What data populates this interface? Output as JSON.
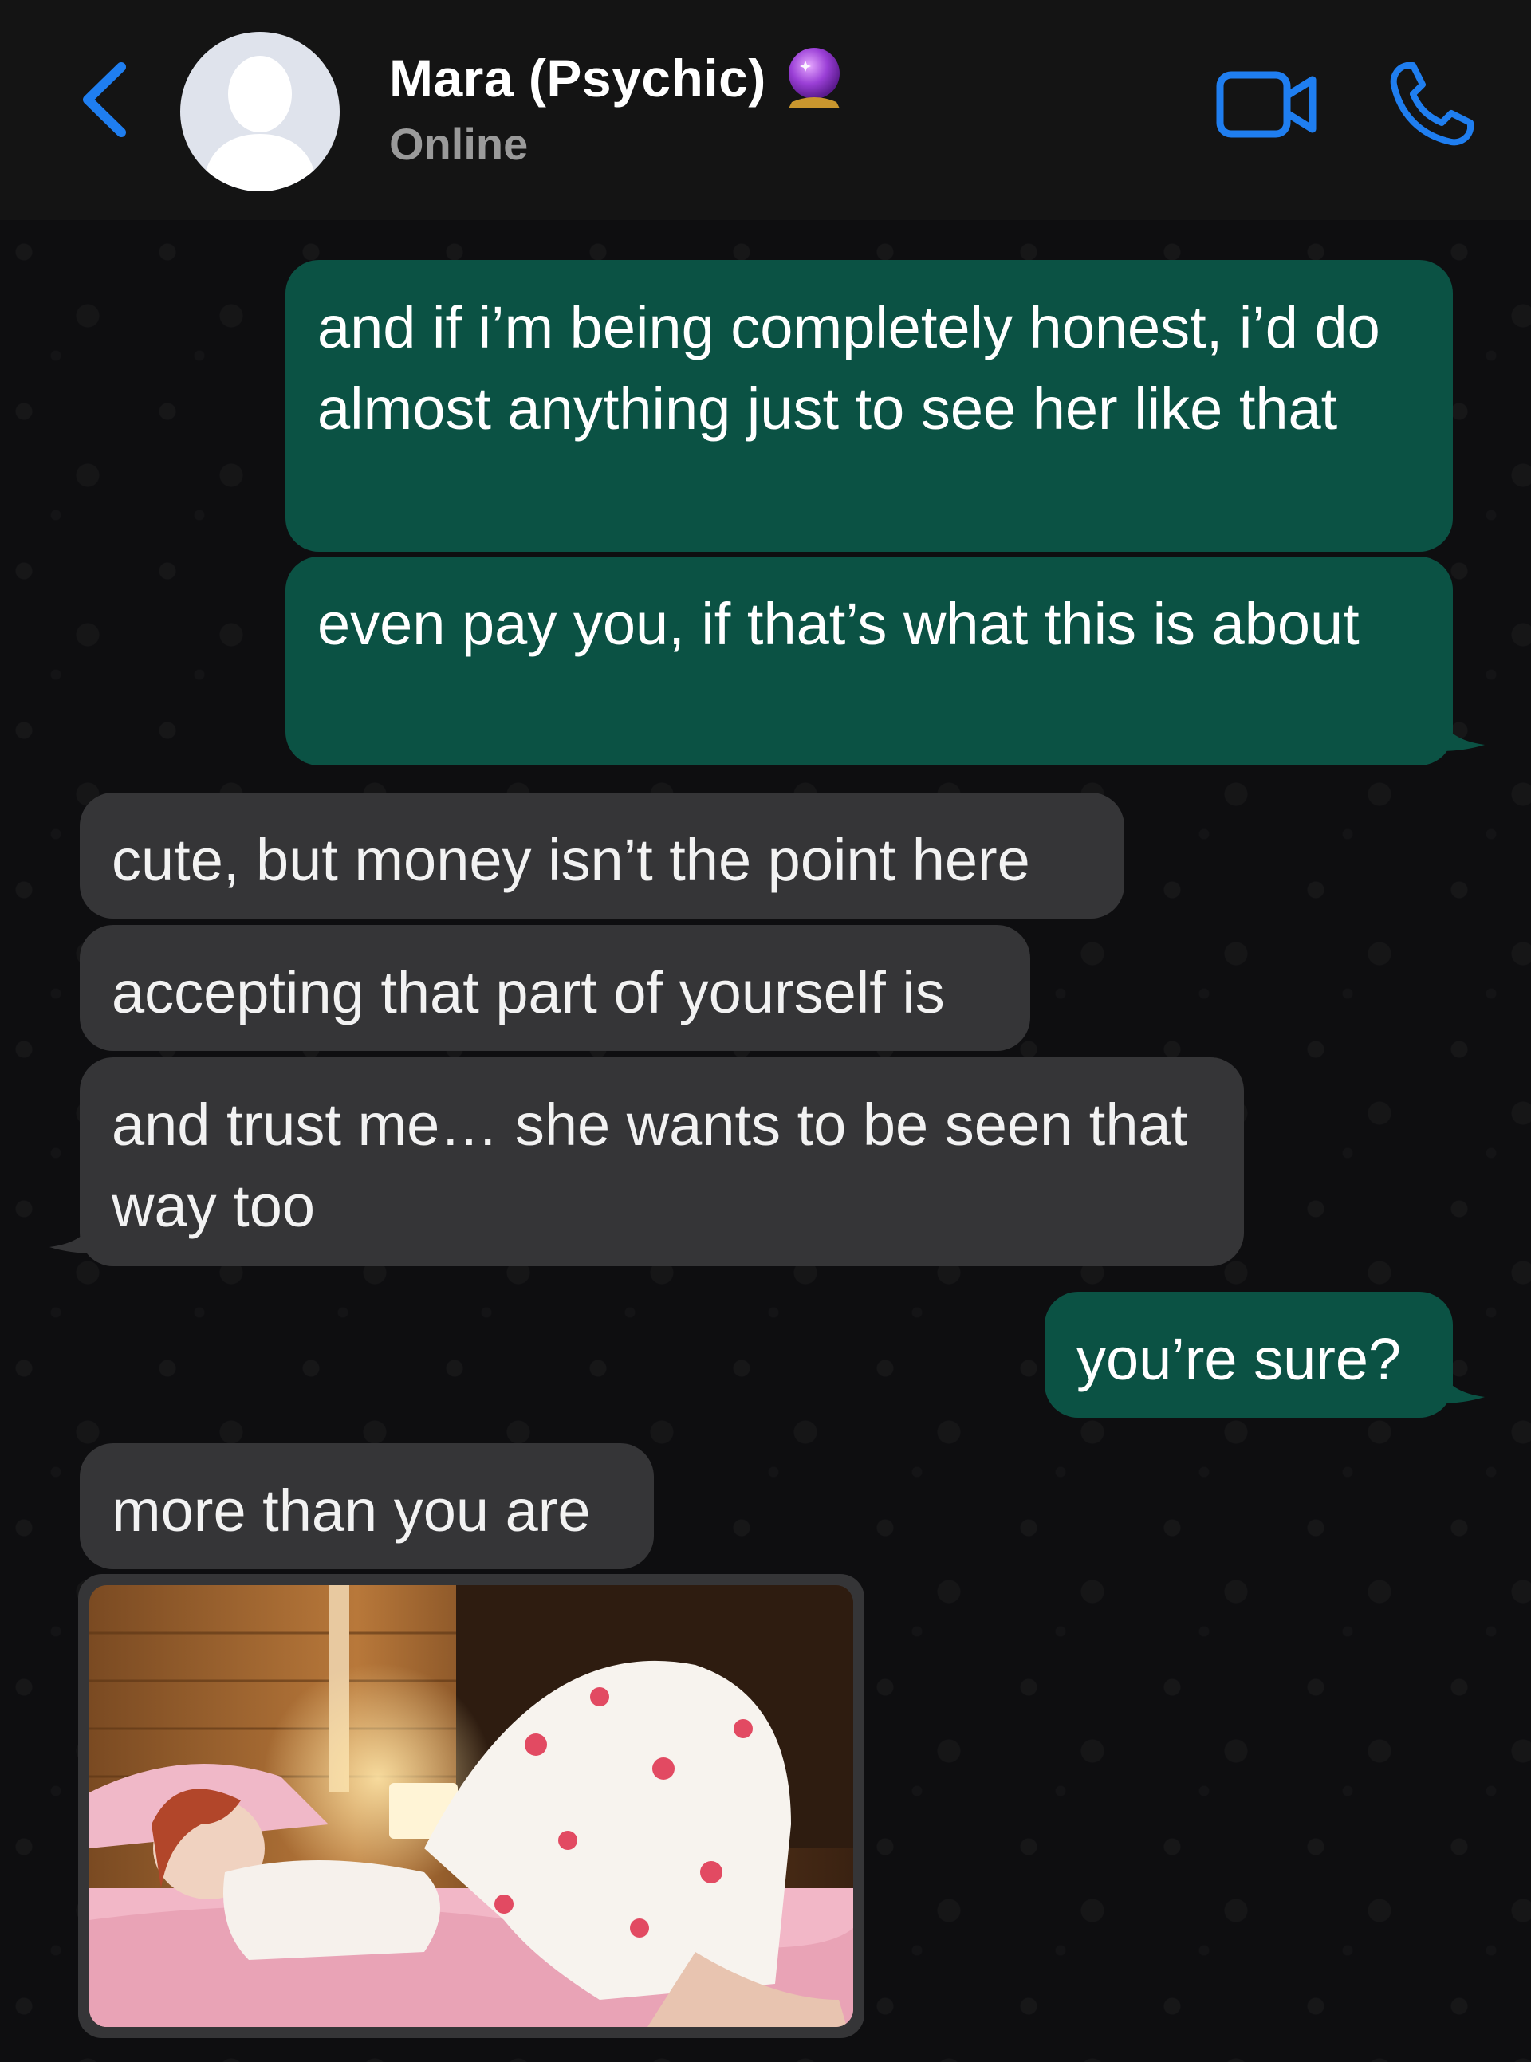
{
  "header": {
    "contact_name": "Mara (Psychic)",
    "status": "Online",
    "accent_color": "#1f7ef0",
    "icons": [
      "back-chevron-icon",
      "avatar-placeholder-icon",
      "crystal-ball-emoji",
      "video-call-icon",
      "phone-call-icon"
    ]
  },
  "messages": [
    {
      "direction": "outgoing",
      "text": "and if i’m being completely honest, i’d do almost anything just to see her like that"
    },
    {
      "direction": "outgoing",
      "text": "even pay you, if that’s what this is about"
    },
    {
      "direction": "incoming",
      "text": "cute, but money isn’t the point here"
    },
    {
      "direction": "incoming",
      "text": "accepting that part of yourself is"
    },
    {
      "direction": "incoming",
      "text": "and trust me… she wants to be seen that way too"
    },
    {
      "direction": "outgoing",
      "text": "you’re sure?"
    },
    {
      "direction": "incoming",
      "text": "more than you are"
    },
    {
      "direction": "incoming",
      "type": "photo",
      "description_icon": "photo-attachment"
    }
  ],
  "colors": {
    "outgoing_bubble": "#0b5244",
    "incoming_bubble": "#353537",
    "header_bg": "#141414",
    "chat_bg": "#0e0e10"
  }
}
